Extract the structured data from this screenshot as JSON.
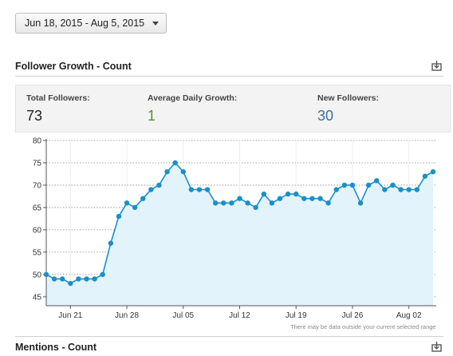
{
  "date_range": {
    "value": "Jun 18, 2015 - Aug 5, 2015"
  },
  "follower_section": {
    "title": "Follower Growth - Count",
    "export_icon": "download-icon"
  },
  "stats": {
    "total_followers": {
      "label": "Total Followers:",
      "value": "73"
    },
    "average_daily_growth": {
      "label": "Average Daily Growth:",
      "value": "1",
      "color": "#4a9a2e"
    },
    "new_followers": {
      "label": "New Followers:",
      "value": "30",
      "color": "#3a6ea5"
    }
  },
  "chart_note": "There may be data outside your current selected range",
  "mentions_section": {
    "title": "Mentions - Count",
    "export_icon": "download-icon"
  },
  "colors": {
    "line": "#1a8fc9",
    "area": "#e3f3fb"
  },
  "chart_data": {
    "type": "area",
    "x_start": "2015-06-18",
    "x_end": "2015-08-05",
    "xticks": [
      "Jun 21",
      "Jun 28",
      "Jul 05",
      "Jul 12",
      "Jul 19",
      "Jul 26",
      "Aug 02"
    ],
    "ylim": [
      43,
      80
    ],
    "yticks": [
      45,
      50,
      55,
      60,
      65,
      70,
      75,
      80
    ],
    "grid": true,
    "values": [
      50,
      49,
      49,
      48,
      49,
      49,
      49,
      50,
      57,
      63,
      66,
      65,
      67,
      69,
      70,
      73,
      75,
      73,
      69,
      69,
      69,
      66,
      66,
      66,
      67,
      66,
      65,
      68,
      66,
      67,
      68,
      68,
      67,
      67,
      67,
      66,
      69,
      70,
      70,
      66,
      70,
      71,
      69,
      70,
      69,
      69,
      69,
      72,
      73
    ]
  }
}
